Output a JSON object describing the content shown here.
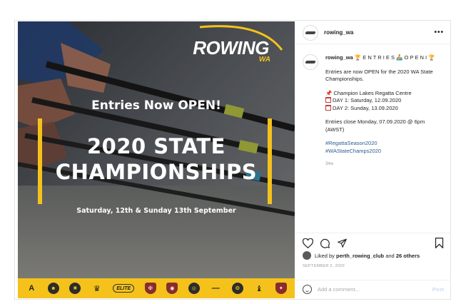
{
  "post": {
    "username": "rowing_wa",
    "more_icon": "more-horizontal-icon",
    "image": {
      "brand_name": "ROWING",
      "brand_sub": "WA",
      "headline_top": "Entries Now OPEN!",
      "headline_main_1": "2020 STATE",
      "headline_main_2": "CHAMPIONSHIPS",
      "headline_dates": "Saturday, 12th & Sunday 13th September",
      "accent_color": "#f4c21b",
      "sponsors": [
        "A",
        "☻",
        "✺",
        "♛",
        "ELITE",
        "✠",
        "◉",
        "◎",
        "—",
        "❂",
        "♝",
        "✦"
      ]
    },
    "caption": {
      "user": "rowing_wa",
      "title_text": " E N T R I E S ",
      "title_text_2": " O P E N I ",
      "para1": "Entries are now OPEN for the 2020 WA State Championships.",
      "venue": "Champion Lakes Regatta Centre",
      "day1": "DAY 1: Saturday, 12.09.2020",
      "day2": "DAY 2: Sunday, 13.09.2020",
      "entries_close": "Entries close Monday, 07.09.2020 @ 6pm (AWST)",
      "hashtag1": "#RegattaSeason2020",
      "hashtag2": "#WAStateChamps2020",
      "time_ago": "34w"
    },
    "likes": {
      "prefix": "Liked by",
      "liker": "perth_rowing_club",
      "conj": "and",
      "others": "26 others"
    },
    "date": "SEPTEMBER 2, 2020",
    "comment": {
      "placeholder": "Add a comment...",
      "post_label": "Post"
    }
  }
}
